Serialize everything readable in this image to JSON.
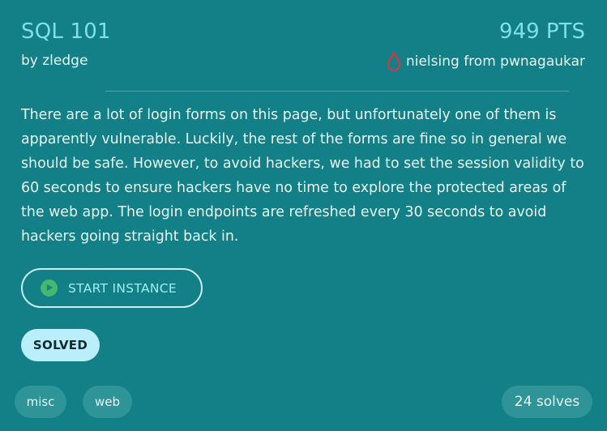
{
  "challenge": {
    "title": "SQL 101",
    "author": "by zledge",
    "points": "949 PTS",
    "first_blood": {
      "icon": "blood-drop-icon",
      "text": "nielsing from pwnagaukar",
      "icon_color": "#e0323a"
    },
    "description": "There are a lot of login forms on this page, but unfortunately one of them is apparently vulnerable. Luckily, the rest of the forms are fine so in general we should be safe. However, to avoid hackers, we had to set the session validity to 60 seconds to ensure hackers have no time to explore the protected areas of the web app. The login endpoints are refreshed every 30 seconds to avoid hackers going straight back in.",
    "start_button": {
      "label": "START INSTANCE",
      "icon": "play-icon",
      "icon_color": "#46b86e"
    },
    "status_badge": "SOLVED",
    "tags": [
      "misc",
      "web"
    ],
    "solves": "24 solves"
  },
  "colors": {
    "background": "#137f86",
    "accent": "#7fe0e8",
    "badge": "#b9eefa",
    "tag_bg": "#2e9498"
  }
}
